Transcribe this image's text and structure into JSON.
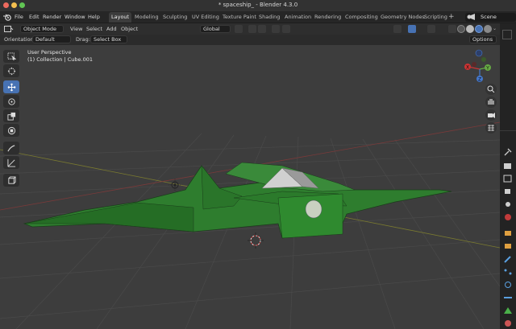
{
  "window": {
    "title": "* spaceship_ - Blender 4.3.0"
  },
  "menu": {
    "file": "File",
    "edit": "Edit",
    "render": "Render",
    "window": "Window",
    "help": "Help"
  },
  "workspaces": [
    "Layout",
    "Modeling",
    "Sculpting",
    "UV Editing",
    "Texture Paint",
    "Shading",
    "Animation",
    "Rendering",
    "Compositing",
    "Geometry Nodes",
    "Scripting"
  ],
  "active_workspace": "Layout",
  "scene": {
    "label": "Scene"
  },
  "header": {
    "mode": "Object Mode",
    "view": "View",
    "select": "Select",
    "add": "Add",
    "object": "Object",
    "transform": "Global"
  },
  "subheader": {
    "orientation_label": "Orientation:",
    "orientation_value": "Default",
    "drag_label": "Drag:",
    "drag_value": "Select Box",
    "options": "Options"
  },
  "viewport": {
    "perspective": "User Perspective",
    "collection": "(1) Collection | Cube.001"
  },
  "gizmo": {
    "x": "X",
    "y": "Y",
    "z": "Z"
  },
  "colors": {
    "accent": "#4772b3",
    "model_green": "#2e7d2e",
    "viewport_bg": "#3d3d3d"
  },
  "icons": [
    "select-box-icon",
    "cursor-icon",
    "move-icon",
    "rotate-icon",
    "scale-icon",
    "transform-icon",
    "annotate-icon",
    "measure-icon",
    "add-cube-icon"
  ]
}
